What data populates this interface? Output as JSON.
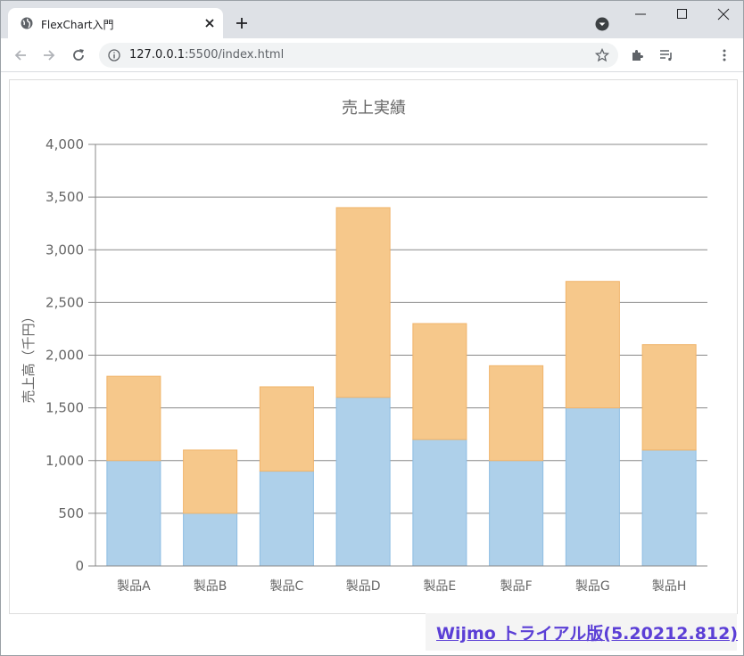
{
  "browser": {
    "tab_title": "FlexChart入門",
    "url_host": "127.0.0.1",
    "url_rest": ":5500/index.html"
  },
  "banner": {
    "text": "Wijmo トライアル版(5.20212.812)"
  },
  "colors": {
    "series1": "#aed0ea",
    "series1_stroke": "#8dbde3",
    "series2": "#f6c88b",
    "series2_stroke": "#f0b46a",
    "grid": "#888888",
    "text": "#666666"
  },
  "chart_data": {
    "type": "bar",
    "stacked": true,
    "title": "売上実績",
    "xlabel": "",
    "ylabel": "売上高（千円）",
    "categories": [
      "製品A",
      "製品B",
      "製品C",
      "製品D",
      "製品E",
      "製品F",
      "製品G",
      "製品H"
    ],
    "series": [
      {
        "values": [
          1000,
          500,
          900,
          1600,
          1200,
          1000,
          1500,
          1100
        ]
      },
      {
        "values": [
          800,
          600,
          800,
          1800,
          1100,
          900,
          1200,
          1000
        ]
      }
    ],
    "ylim": [
      0,
      4000
    ],
    "yticks": [
      "0",
      "500",
      "1,000",
      "1,500",
      "2,000",
      "2,500",
      "3,000",
      "3,500",
      "4,000"
    ],
    "grid": true,
    "legend": "none"
  }
}
